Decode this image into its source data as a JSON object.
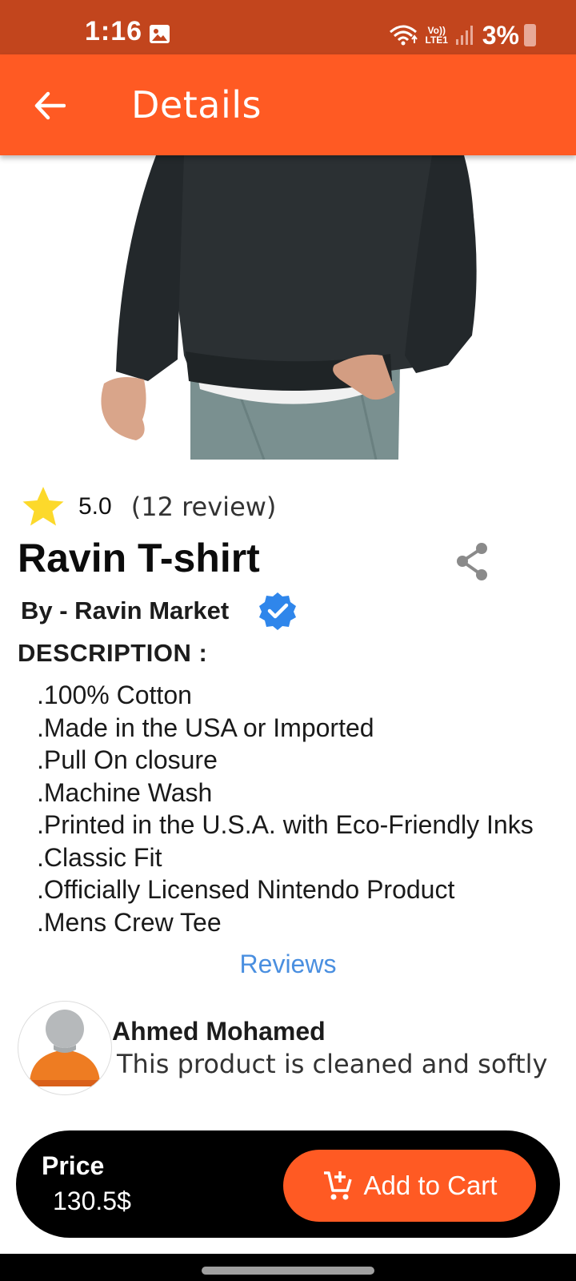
{
  "status_bar": {
    "time": "1:16",
    "network_label": "Vo)) LTE1",
    "battery_percent": "3%",
    "icons": [
      "image-icon",
      "wifi-icon",
      "volte-icon",
      "signal-icon",
      "battery-icon"
    ]
  },
  "app_bar": {
    "title": "Details",
    "back_icon": "arrow-back-icon"
  },
  "product": {
    "image": "product-photo-dark-sweatshirt",
    "rating": "5.0",
    "review_count": "(12 review)",
    "title": "Ravin T-shirt",
    "seller": "By - Ravin Market",
    "verified": true,
    "description_heading": "DESCRIPTION  :",
    "description_items": [
      ".100% Cotton",
      ".Made in the USA or Imported",
      ".Pull On closure",
      ".Machine Wash",
      ".Printed in the U.S.A. with Eco-Friendly Inks",
      ".Classic Fit",
      ".Officially Licensed Nintendo Product",
      ".Mens Crew Tee"
    ]
  },
  "reviews": {
    "link_label": "Reviews",
    "items": [
      {
        "name": "Ahmed Mohamed",
        "text": "This product is cleaned and softly"
      }
    ]
  },
  "purchase": {
    "price_label": "Price",
    "price_value": "130.5$",
    "add_to_cart_label": "Add to Cart"
  },
  "colors": {
    "status_bar": "#c2451d",
    "app_bar": "#ff5a23",
    "accent_link": "#4a8fe0",
    "star": "#fcd92b",
    "verified": "#2f86eb",
    "bottom_bar": "#000000"
  }
}
